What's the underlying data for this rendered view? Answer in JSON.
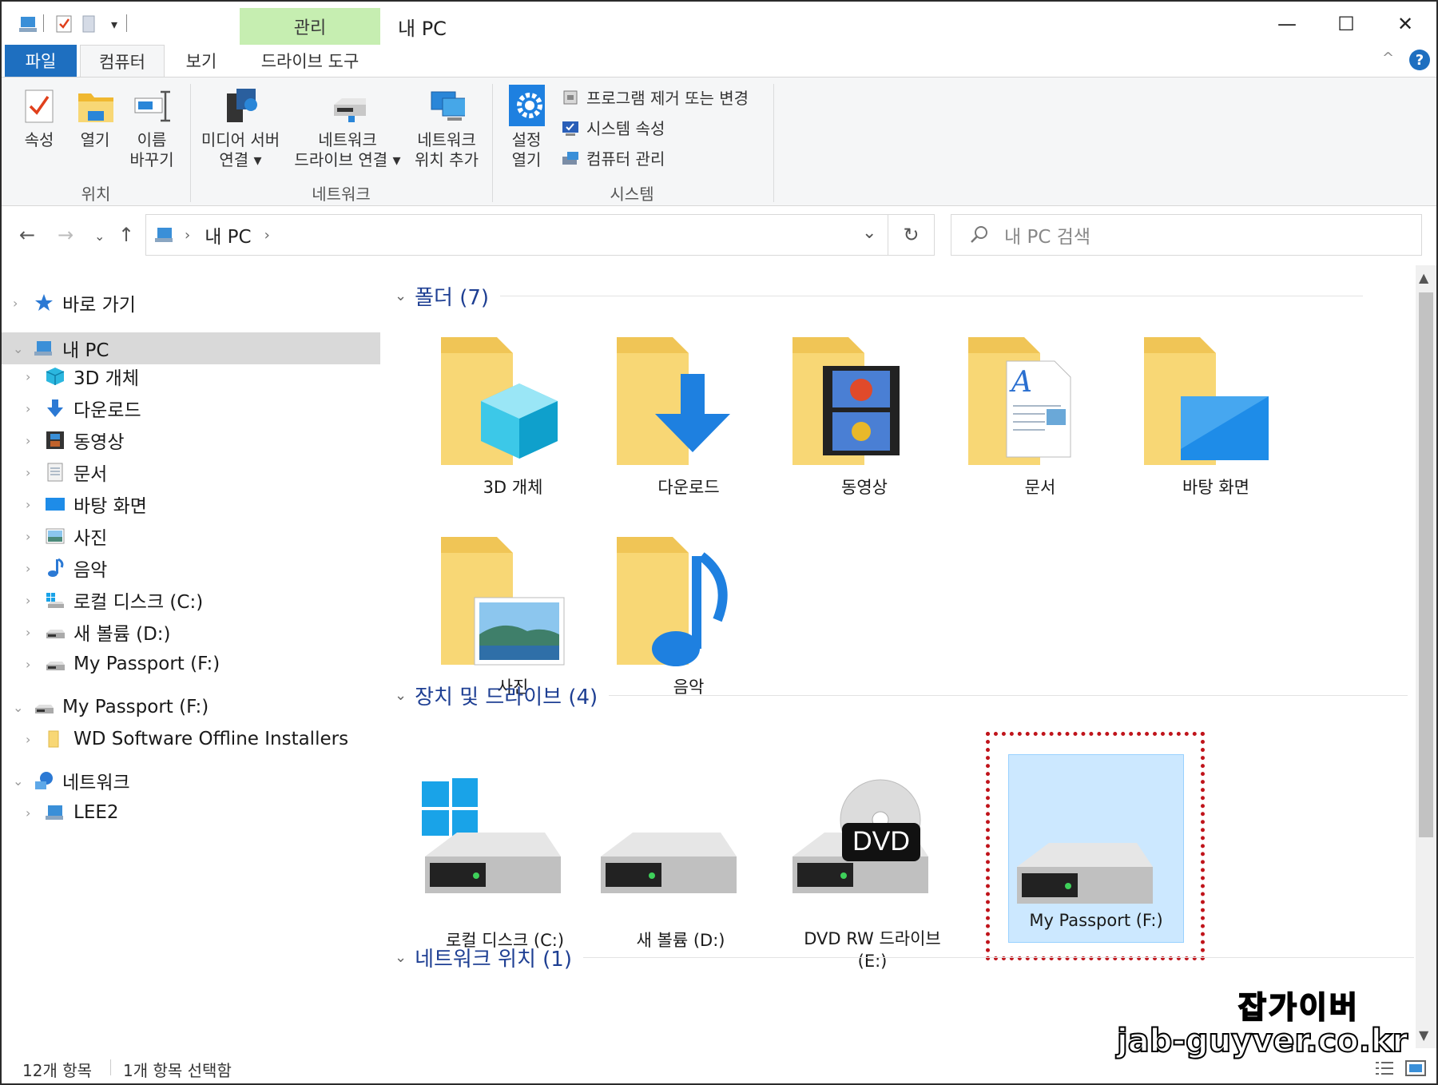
{
  "window": {
    "title": "내 PC",
    "contextual_tab_group": "관리",
    "controls": {
      "minimize": "—",
      "maximize": "☐",
      "close": "✕"
    }
  },
  "ribbon_tabs": {
    "file": "파일",
    "computer": "컴퓨터",
    "view": "보기",
    "drive_tools": "드라이브 도구"
  },
  "ribbon": {
    "location": {
      "group": "위치",
      "properties": "속성",
      "open": "열기",
      "rename_1": "이름",
      "rename_2": "바꾸기"
    },
    "network": {
      "group": "네트워크",
      "media_server_1": "미디어 서버",
      "media_server_2": "연결 ▾",
      "map_drive_1": "네트워크",
      "map_drive_2": "드라이브 연결 ▾",
      "add_location_1": "네트워크",
      "add_location_2": "위치 추가"
    },
    "system": {
      "group": "시스템",
      "open_settings_1": "설정",
      "open_settings_2": "열기",
      "uninstall": "프로그램 제거 또는 변경",
      "system_properties": "시스템 속성",
      "manage": "컴퓨터 관리"
    },
    "collapse_glyph": "^",
    "help_glyph": "?"
  },
  "address_bar": {
    "crumb": "내 PC",
    "separator": "›",
    "dropdown_glyph": "⌄",
    "refresh_glyph": "↻"
  },
  "search": {
    "placeholder": "내 PC 검색"
  },
  "nav_pane": {
    "quick_access": "바로 가기",
    "this_pc": "내 PC",
    "items": [
      "3D 개체",
      "다운로드",
      "동영상",
      "문서",
      "바탕 화면",
      "사진",
      "음악",
      "로컬 디스크 (C:)",
      "새 볼륨 (D:)",
      "My Passport (F:)"
    ],
    "passport": "My Passport (F:)",
    "passport_child": "WD Software Offline Installers",
    "network": "네트워크",
    "network_child": "LEE2"
  },
  "sections": {
    "folders": "폴더 (7)",
    "devices": "장치 및 드라이브 (4)",
    "network_locations": "네트워크 위치 (1)"
  },
  "folders": [
    "3D 개체",
    "다운로드",
    "동영상",
    "문서",
    "바탕 화면",
    "사진",
    "음악"
  ],
  "drives": {
    "c": "로컬 디스크 (C:)",
    "d": "새 볼륨 (D:)",
    "e_1": "DVD RW 드라이브",
    "e_2": "(E:)",
    "f": "My Passport (F:)",
    "dvd_badge": "DVD"
  },
  "status": {
    "count": "12개 항목",
    "selected": "1개 항목 선택함"
  },
  "watermark": {
    "line1": "잡가이버",
    "line2": "jab-guyver.co.kr"
  },
  "colors": {
    "accent": "#1e6fc0",
    "contextual": "#c6eeb1",
    "selection": "#cce8ff",
    "highlight_border": "#c0141b",
    "folder": "#f8d775"
  }
}
